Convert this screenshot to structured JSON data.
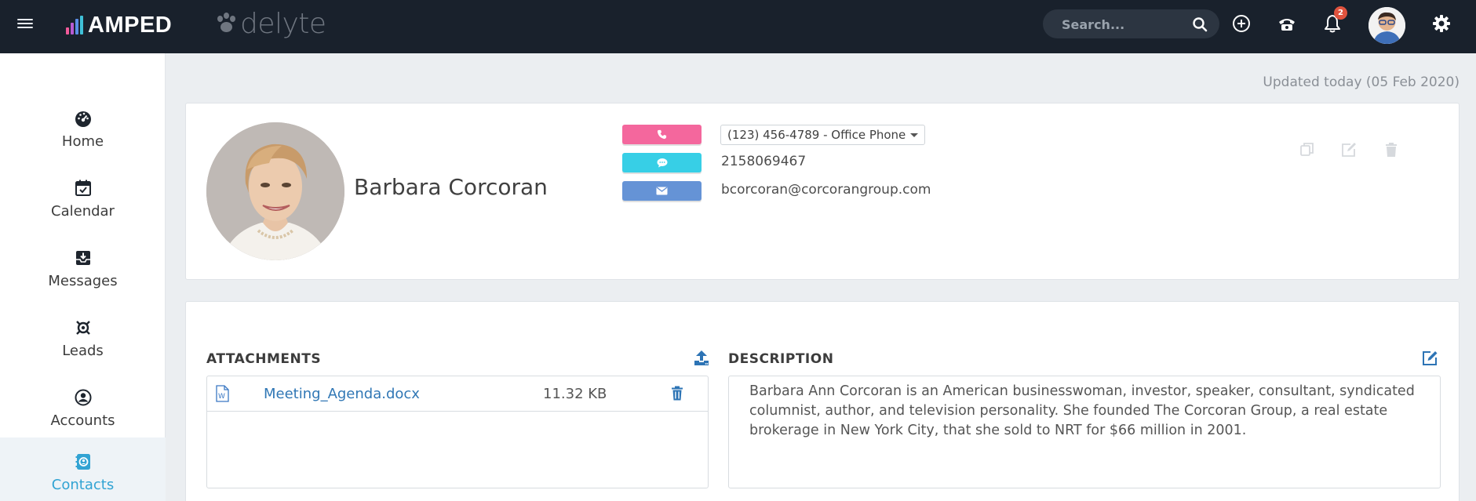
{
  "header": {
    "brand": "AMPED",
    "brand_secondary": "delyte",
    "search_placeholder": "Search...",
    "notification_count": "2",
    "icons": [
      "menu-icon",
      "search-icon",
      "add-circle-icon",
      "phone-icon",
      "bell-icon",
      "settings-icon"
    ]
  },
  "sidebar": {
    "items": [
      {
        "label": "Home",
        "icon": "dashboard-icon",
        "active": false
      },
      {
        "label": "Calendar",
        "icon": "calendar-icon",
        "active": false
      },
      {
        "label": "Messages",
        "icon": "inbox-icon",
        "active": false
      },
      {
        "label": "Leads",
        "icon": "leads-icon",
        "active": false
      },
      {
        "label": "Accounts",
        "icon": "account-icon",
        "active": false
      },
      {
        "label": "Contacts",
        "icon": "contacts-icon",
        "active": true
      }
    ]
  },
  "page": {
    "updated_text": "Updated today (05 Feb 2020)"
  },
  "contact": {
    "name": "Barbara Corcoran",
    "phone_selected": "(123) 456-4789 - Office Phone",
    "sms_number": "2158069467",
    "email": "bcorcoran@corcorangroup.com",
    "actions": [
      "copy-icon",
      "edit-icon",
      "delete-icon"
    ]
  },
  "attachments": {
    "title": "ATTACHMENTS",
    "files": [
      {
        "name": "Meeting_Agenda.docx",
        "size": "11.32 KB"
      }
    ]
  },
  "description": {
    "title": "DESCRIPTION",
    "text": "Barbara Ann Corcoran is an American businesswoman, investor, speaker, consultant, syndicated columnist, author, and television personality. She founded The Corcoran Group, a real estate brokerage in New York City, that she sold to NRT for $66 million in 2001."
  },
  "colors": {
    "topbar": "#19212c",
    "phone_button": "#f4679d",
    "sms_button": "#37cfe6",
    "email_button": "#6593d6",
    "link": "#3077b5",
    "active_nav": "#31a3d3"
  }
}
